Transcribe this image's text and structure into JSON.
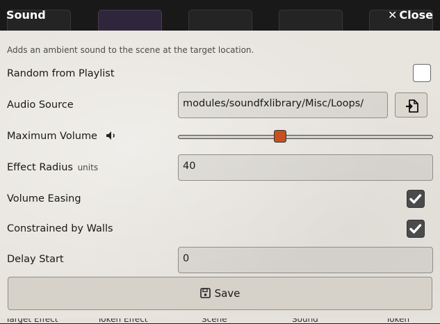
{
  "window": {
    "title": "Sound",
    "close_label": "Close"
  },
  "hint": "Adds an ambient sound to the scene at the target location.",
  "fields": {
    "random_from_playlist": {
      "label": "Random from Playlist",
      "checked": false
    },
    "audio_source": {
      "label": "Audio Source",
      "value": "modules/soundfxlibrary/Misc/Loops/"
    },
    "maximum_volume": {
      "label": "Maximum Volume",
      "value": 0.4
    },
    "effect_radius": {
      "label": "Effect Radius",
      "units": "units",
      "value": "40"
    },
    "volume_easing": {
      "label": "Volume Easing",
      "checked": true
    },
    "constrained_by_walls": {
      "label": "Constrained by Walls",
      "checked": true
    },
    "delay_start": {
      "label": "Delay Start",
      "value": "0"
    }
  },
  "save_label": "Save",
  "background_bottom": [
    "Target Effect",
    "Token Effect",
    "Scene",
    "Sound",
    "Token"
  ],
  "colors": {
    "accent": "#c7501f",
    "panel": "#e8e5df"
  },
  "icons": {
    "volume": "volume-icon",
    "file_picker": "file-import-icon",
    "save": "save-icon",
    "close": "close-icon"
  }
}
